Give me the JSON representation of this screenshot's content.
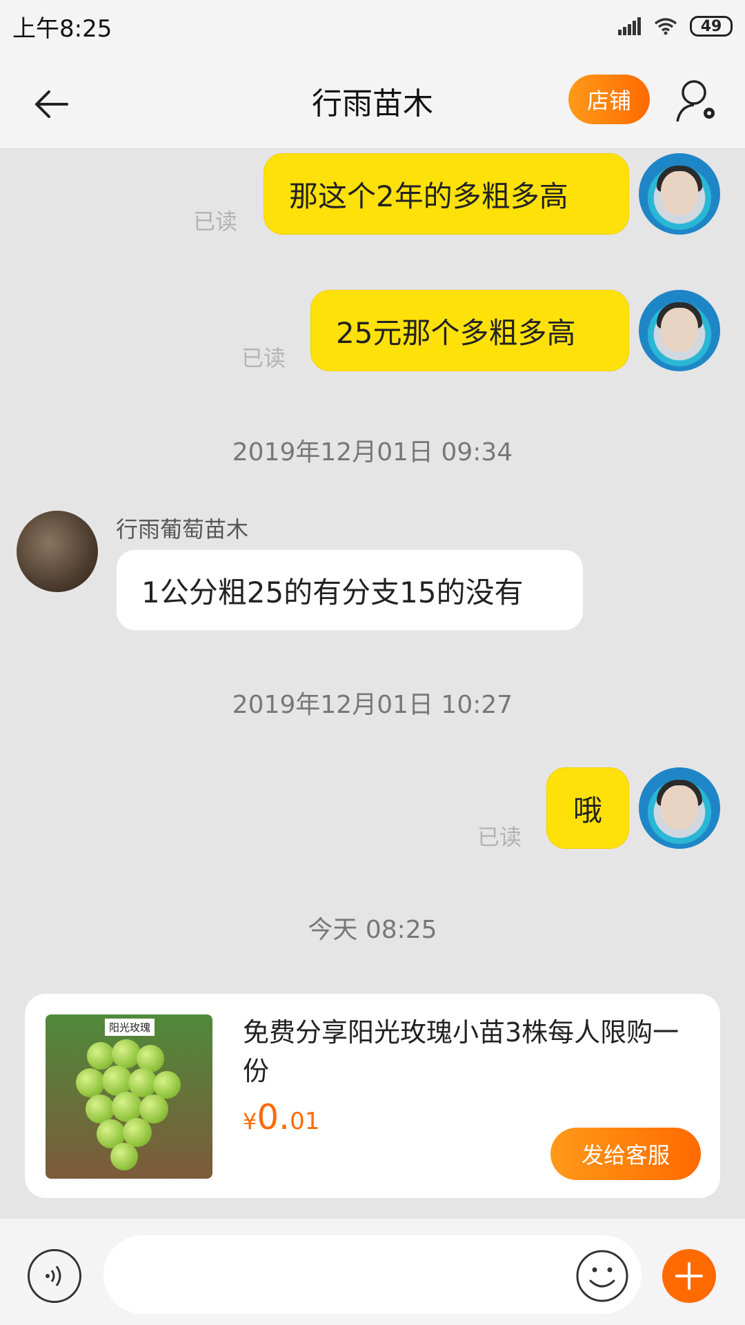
{
  "status_bar": {
    "time": "上午8:25",
    "battery": "49"
  },
  "header": {
    "title": "行雨苗木",
    "shop_button": "店铺"
  },
  "messages": {
    "m1": {
      "text": "那这个2年的多粗多高",
      "read": "已读"
    },
    "m2": {
      "text": "25元那个多粗多高",
      "read": "已读"
    },
    "ts1": "2019年12月01日 09:34",
    "m3": {
      "sender": "行雨葡萄苗木",
      "text": "1公分粗25的有分支15的没有"
    },
    "ts2": "2019年12月01日 10:27",
    "m4": {
      "text": "哦",
      "read": "已读"
    },
    "ts3": "今天  08:25"
  },
  "product": {
    "image_label": "阳光玫瑰",
    "title": "免费分享阳光玫瑰小苗3株每人限购一份",
    "price_symbol": "¥",
    "price_int": "0.",
    "price_dec": "01",
    "send_button": "发给客服"
  },
  "input": {
    "placeholder": "",
    "value": ""
  },
  "colors": {
    "accent": "#ff6a00",
    "my_bubble": "#ffe10a",
    "background": "#e5e5e5"
  },
  "icons": [
    "back-arrow-icon",
    "user-settings-icon",
    "voice-icon",
    "emoji-icon",
    "plus-icon",
    "signal-icon",
    "wifi-icon",
    "battery-icon"
  ]
}
